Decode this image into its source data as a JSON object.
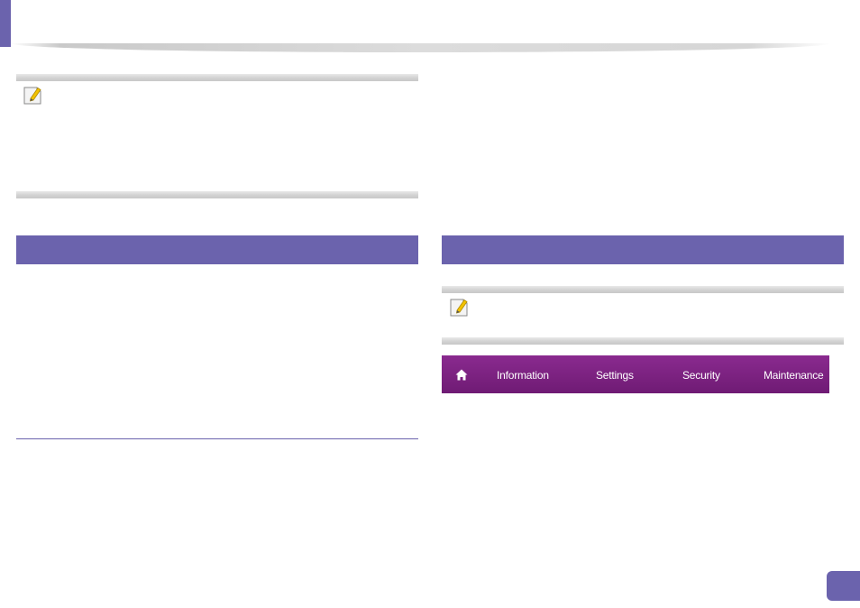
{
  "web_service_menu": {
    "home_icon": "home-icon",
    "items": [
      {
        "label": "Information"
      },
      {
        "label": "Settings"
      },
      {
        "label": "Security"
      },
      {
        "label": "Maintenance"
      }
    ],
    "colors": {
      "top": "#8a2a8f",
      "bottom": "#6f1b74",
      "text": "#ffffff"
    }
  },
  "note_icon": "note-pencil-icon",
  "accent_color": "#6b63ad"
}
